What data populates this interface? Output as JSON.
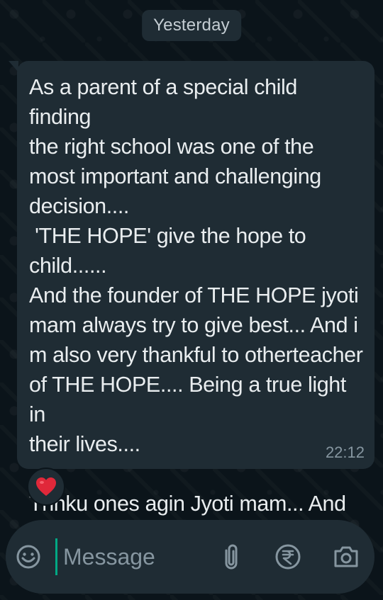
{
  "date_chip": "Yesterday",
  "message": {
    "text": "As a parent of a special child finding\nthe right school was one of the\nmost important and challenging\ndecision....\n 'THE HOPE' give the hope to child......\nAnd the founder of THE HOPE jyoti\nmam always try to give best... And i\nm also very thankful to otherteacher\nof THE HOPE.... Being a true light in\ntheir lives....\n\nThnku ones agin Jyoti mam... And\nTHE HOPE",
    "time": "22:12",
    "reaction": "heart-icon"
  },
  "input_bar": {
    "placeholder": "Message",
    "icons": [
      "emoji-icon",
      "attach-icon",
      "rupee-icon",
      "camera-icon"
    ]
  },
  "colors": {
    "background": "#0b141a",
    "bubble": "#1f2c34",
    "text": "#e9edef",
    "meta": "#8696a0",
    "accent": "#00a884",
    "heart": "#e0283a"
  }
}
